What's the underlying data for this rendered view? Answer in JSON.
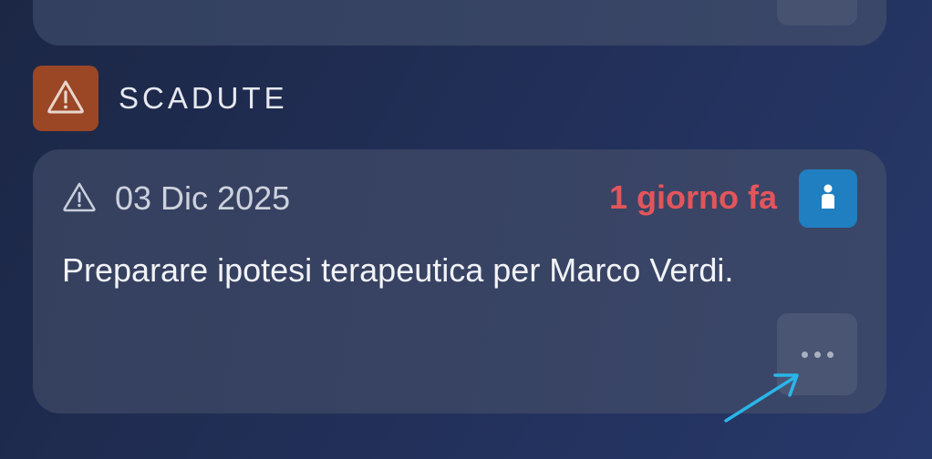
{
  "section": {
    "title": "SCADUTE",
    "icon": "warning-icon",
    "accent": "#9b4625"
  },
  "task": {
    "date": "03 Dic 2025",
    "relative_time": "1 giorno fa",
    "description": "Preparare ipotesi terapeutica per Marco Verdi.",
    "date_icon": "warning-icon",
    "badge_icon": "user-icon",
    "overdue_color": "#e3555b",
    "badge_color": "#1f7fc0"
  },
  "actions": {
    "more_icon": "ellipsis-icon"
  }
}
